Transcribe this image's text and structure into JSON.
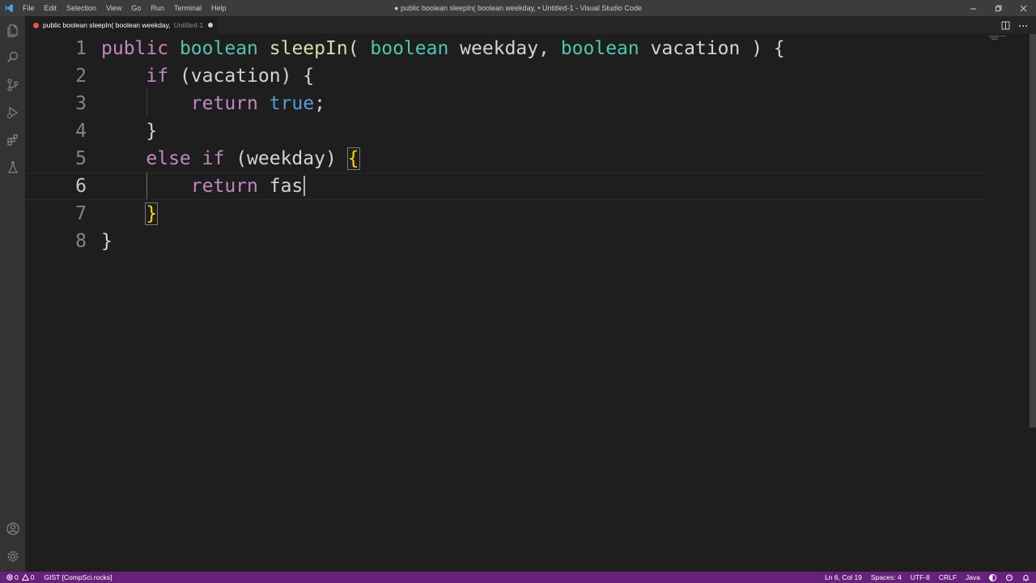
{
  "titlebar": {
    "menu": [
      "File",
      "Edit",
      "Selection",
      "View",
      "Go",
      "Run",
      "Terminal",
      "Help"
    ],
    "window_title": "● public boolean sleepIn( boolean weekday, • Untitled-1 - Visual Studio Code"
  },
  "tab": {
    "title": "public boolean sleepIn( boolean weekday,",
    "subtitle": "Untitled-1"
  },
  "editor": {
    "line_numbers": [
      "1",
      "2",
      "3",
      "4",
      "5",
      "6",
      "7",
      "8"
    ],
    "cursor_line": "6",
    "lines": [
      [
        {
          "t": "public",
          "c": "kw"
        },
        {
          "t": " ",
          "c": "pl"
        },
        {
          "t": "boolean",
          "c": "ty"
        },
        {
          "t": " ",
          "c": "pl"
        },
        {
          "t": "sleepIn",
          "c": "fn"
        },
        {
          "t": "( ",
          "c": "pl"
        },
        {
          "t": "boolean",
          "c": "ty"
        },
        {
          "t": " weekday, ",
          "c": "pl"
        },
        {
          "t": "boolean",
          "c": "ty"
        },
        {
          "t": " vacation ) {",
          "c": "pl"
        }
      ],
      [
        {
          "t": "    ",
          "c": "pl"
        },
        {
          "t": "if",
          "c": "kw"
        },
        {
          "t": " (vacation) {",
          "c": "pl"
        }
      ],
      [
        {
          "t": "        ",
          "c": "pl"
        },
        {
          "t": "return",
          "c": "kw"
        },
        {
          "t": " ",
          "c": "pl"
        },
        {
          "t": "true",
          "c": "bl"
        },
        {
          "t": ";",
          "c": "pl"
        }
      ],
      [
        {
          "t": "    }",
          "c": "pl"
        }
      ],
      [
        {
          "t": "    ",
          "c": "pl"
        },
        {
          "t": "else",
          "c": "kw"
        },
        {
          "t": " ",
          "c": "pl"
        },
        {
          "t": "if",
          "c": "kw"
        },
        {
          "t": " (weekday) ",
          "c": "pl"
        },
        {
          "t": "{",
          "c": "br bm"
        }
      ],
      [
        {
          "t": "        ",
          "c": "pl"
        },
        {
          "t": "return",
          "c": "kw"
        },
        {
          "t": " fas",
          "c": "pl"
        }
      ],
      [
        {
          "t": "    ",
          "c": "pl"
        },
        {
          "t": "}",
          "c": "br bm"
        }
      ],
      [
        {
          "t": "}",
          "c": "pl"
        }
      ]
    ]
  },
  "statusbar": {
    "errors": "0",
    "warnings": "0",
    "remote": "GIST [CompSci.rocks]",
    "position": "Ln 6, Col 19",
    "spaces": "Spaces: 4",
    "encoding": "UTF-8",
    "eol": "CRLF",
    "language": "Java"
  },
  "icons": {
    "activity": [
      "explorer-icon",
      "search-icon",
      "source-control-icon",
      "run-debug-icon",
      "extensions-icon",
      "testing-icon"
    ],
    "activity_bottom": [
      "account-icon",
      "settings-gear-icon"
    ]
  },
  "colors": {
    "statusbar": "#68217a",
    "keyword": "#c586c0",
    "type": "#4ec9b0",
    "function": "#dcdcaa",
    "literal": "#569cd6",
    "bracket": "#ffd700"
  }
}
